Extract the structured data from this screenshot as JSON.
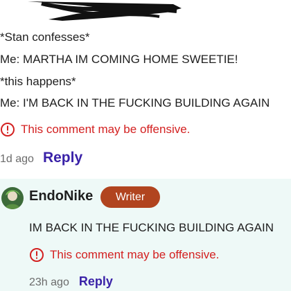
{
  "parent_comment": {
    "lines": [
      "*Stan confesses*",
      "Me: MARTHA IM COMING HOME SWEETIE!",
      "*this happens*",
      "Me: I'M BACK IN THE FUCKING BUILDING AGAIN"
    ],
    "warning": "This comment may be offensive.",
    "time": "1d ago",
    "reply_label": "Reply"
  },
  "reply_comment": {
    "username": "EndoNike",
    "badge": "Writer",
    "text": "IM BACK IN THE FUCKING BUILDING AGAIN",
    "warning": "This comment may be offensive.",
    "time": "23h ago",
    "reply_label": "Reply"
  },
  "colors": {
    "warning": "#d32020",
    "link": "#3a22a8",
    "badge": "#b1441f",
    "reply_background": "#eef9f7"
  },
  "icons": {
    "warning": "exclamation-circle-icon",
    "avatar": "user-avatar-icon"
  }
}
